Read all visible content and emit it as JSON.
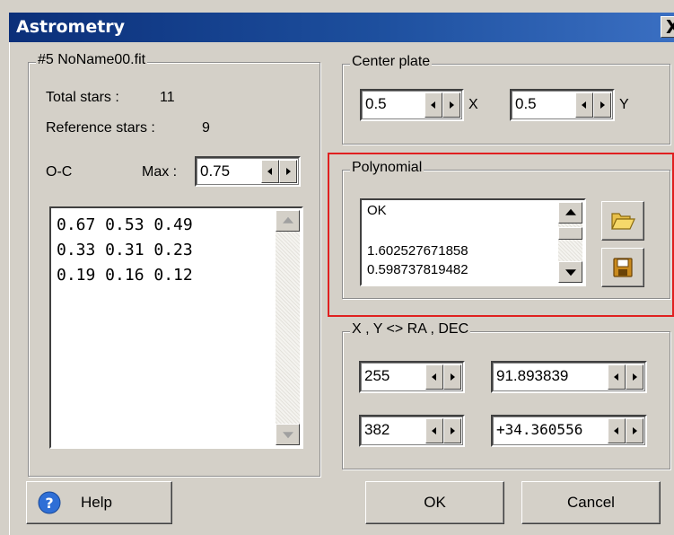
{
  "window": {
    "title": "Astrometry",
    "close_glyph": "X"
  },
  "left_panel": {
    "legend": "#5 NoName00.fit",
    "total_stars_label": "Total stars :",
    "total_stars_value": "11",
    "reference_stars_label": "Reference stars :",
    "reference_stars_value": "9",
    "oc_label": "O-C",
    "max_label": "Max :",
    "max_value": "0.75",
    "residual_lines": [
      "0.67 0.53 0.49",
      "0.33 0.31 0.23",
      "0.19 0.16 0.12"
    ]
  },
  "center_plate": {
    "legend": "Center plate",
    "x_value": "0.5",
    "x_label": "X",
    "y_value": "0.5",
    "y_label": "Y"
  },
  "polynomial": {
    "legend": "Polynomial",
    "lines": [
      "OK",
      "",
      "1.602527671858",
      "0.598737819482"
    ],
    "open_icon": "folder-open-icon",
    "save_icon": "floppy-save-icon"
  },
  "conversion": {
    "legend": "X , Y  <>  RA , DEC",
    "x_value": "255",
    "ra_value": "91.893839",
    "y_value": "382",
    "dec_value": "+34.360556"
  },
  "buttons": {
    "help": "Help",
    "ok": "OK",
    "cancel": "Cancel"
  },
  "colors": {
    "title_bar": "#0b2f79",
    "face": "#d4d0c8",
    "highlight": "#e02020"
  }
}
